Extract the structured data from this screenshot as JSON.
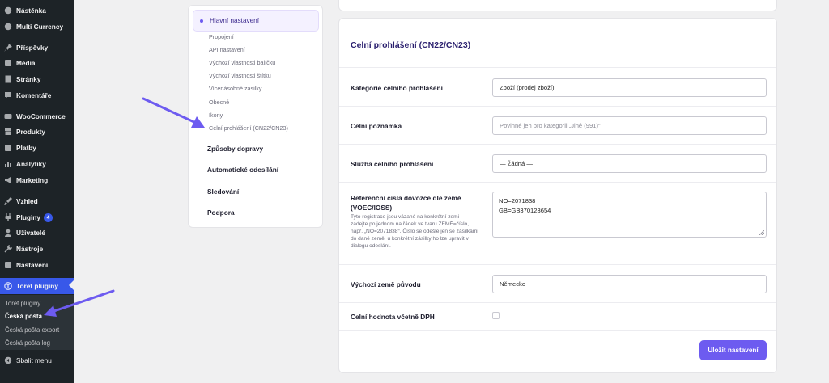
{
  "sidebar": {
    "items": [
      {
        "label": "Nástěnka",
        "icon": "dashboard-icon"
      },
      {
        "label": "Multi Currency",
        "icon": "currency-icon"
      },
      {
        "label": "Příspěvky",
        "icon": "pin-icon"
      },
      {
        "label": "Média",
        "icon": "media-icon"
      },
      {
        "label": "Stránky",
        "icon": "page-icon"
      },
      {
        "label": "Komentáře",
        "icon": "comment-icon"
      },
      {
        "label": "WooCommerce",
        "icon": "woocommerce-icon"
      },
      {
        "label": "Produkty",
        "icon": "archive-icon"
      },
      {
        "label": "Platby",
        "icon": "dollar-icon"
      },
      {
        "label": "Analytiky",
        "icon": "chart-icon"
      },
      {
        "label": "Marketing",
        "icon": "megaphone-icon"
      },
      {
        "label": "Vzhled",
        "icon": "brush-icon"
      },
      {
        "label": "Pluginy",
        "icon": "plugin-icon",
        "badge": "4"
      },
      {
        "label": "Uživatelé",
        "icon": "user-icon"
      },
      {
        "label": "Nástroje",
        "icon": "wrench-icon"
      },
      {
        "label": "Nastavení",
        "icon": "settings-icon"
      },
      {
        "label": "Toret pluginy",
        "icon": "toret-icon"
      },
      {
        "label": "Sbalit menu",
        "icon": "collapse-icon"
      }
    ],
    "submenu": [
      "Toret pluginy",
      "Česká pošta",
      "Česká pošta export",
      "Česká pošta log"
    ]
  },
  "nav": {
    "main": "Hlavní nastavení",
    "subs": [
      "Propojení",
      "API nastavení",
      "Výchozí vlastnosti balíčku",
      "Výchozí vlastnosti štítku",
      "Vícenásobné zásilky",
      "Obecné",
      "Ikony",
      "Celní prohlášení (CN22/CN23)"
    ],
    "sections": [
      "Způsoby dopravy",
      "Automatické odesílání",
      "Sledování",
      "Podpora"
    ]
  },
  "panel": {
    "title": "Celní prohlášení (CN22/CN23)",
    "category_label": "Kategorie celního prohlášení",
    "category_value": "Zboží (prodej zboží)",
    "note_label": "Celní poznámka",
    "note_placeholder": "Povinné jen pro kategorii „Jiné (991)“",
    "service_label": "Služba celního prohlášení",
    "service_value": "— Žádná —",
    "refs_label": "Referenční čísla dovozce dle země (VOEC/IOSS)",
    "refs_desc": "Tyto registrace jsou vázané na konkrétní zemi — zadejte po jednom na řádek ve tvaru ZEMĚ=číslo, např. „NO=2071838“. Číslo se odešle jen se zásilkami do dané země; u konkrétní zásilky ho lze upravit v dialogu odeslání.",
    "refs_lines": [
      "NO=2071838",
      "GB=GB370123654"
    ],
    "origin_label": "Výchozí země původu",
    "origin_value": "Německo",
    "vat_label": "Celní hodnota včetně DPH",
    "save_label": "Uložit nastavení"
  },
  "colors": {
    "accent": "#6d5bf0",
    "wp_sidebar": "#1d2327",
    "wp_active": "#3858e9",
    "title": "#2a1f6e"
  }
}
